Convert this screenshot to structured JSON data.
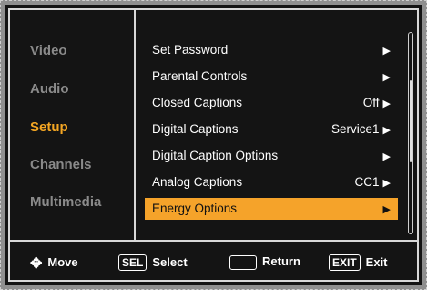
{
  "sidebar": {
    "items": [
      {
        "label": "Video"
      },
      {
        "label": "Audio"
      },
      {
        "label": "Setup"
      },
      {
        "label": "Channels"
      },
      {
        "label": "Multimedia"
      }
    ]
  },
  "menu": {
    "items": [
      {
        "label": "Set Password",
        "value": "",
        "arrow": "▶"
      },
      {
        "label": "Parental Controls",
        "value": "",
        "arrow": "▶"
      },
      {
        "label": "Closed Captions",
        "value": "Off",
        "arrow": "▶"
      },
      {
        "label": "Digital Captions",
        "value": "Service1",
        "arrow": "▶"
      },
      {
        "label": "Digital Caption Options",
        "value": "",
        "arrow": "▶"
      },
      {
        "label": "Analog Captions",
        "value": "CC1",
        "arrow": "▶"
      },
      {
        "label": "Energy Options",
        "value": "",
        "arrow": "▶"
      }
    ]
  },
  "footer": {
    "move_label": "Move",
    "select_key": "SEL",
    "select_label": "Select",
    "return_label": "Return",
    "exit_key": "EXIT",
    "exit_label": "Exit"
  },
  "colors": {
    "accent": "#f5a32a",
    "active_text": "#f4a623",
    "inactive_text": "#8a8a8a",
    "background": "#141414"
  }
}
